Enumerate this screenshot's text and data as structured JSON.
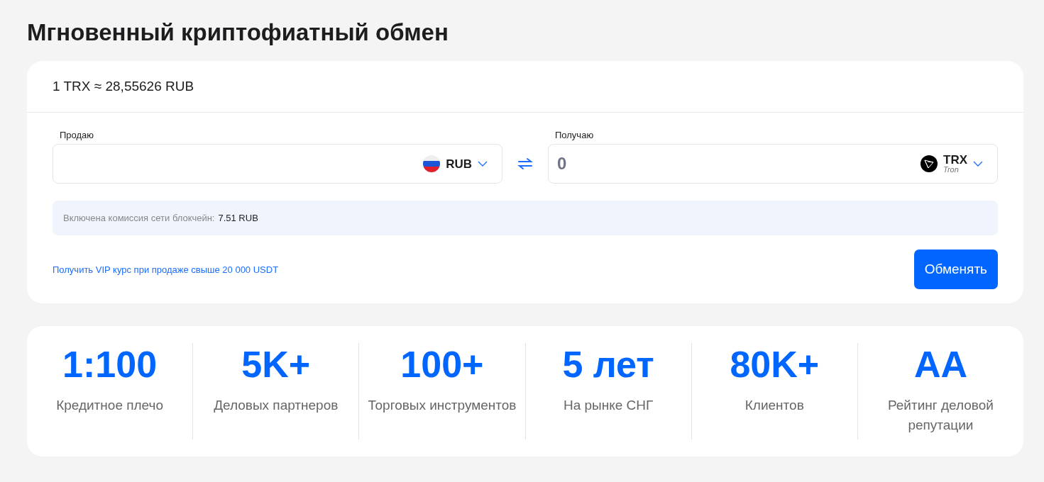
{
  "title": "Мгновенный криптофиатный обмен",
  "exchange": {
    "rate": "1 TRX ≈ 28,55626 RUB",
    "sell": {
      "label": "Продаю",
      "currency": "RUB",
      "kind": "flag"
    },
    "buy": {
      "label": "Получаю",
      "placeholder": "0",
      "currency": "TRX",
      "network": "Tron",
      "kind": "coin"
    },
    "fee": {
      "label": "Включена комиссия сети блокчейн:",
      "value": "7.51 RUB"
    },
    "vip_link": "Получить VIP курс при продаже свыше 20 000 USDT",
    "button": "Обменять"
  },
  "stats": [
    {
      "value": "1:100",
      "label": "Кредитное плечо"
    },
    {
      "value": "5K+",
      "label": "Деловых партнеров"
    },
    {
      "value": "100+",
      "label": "Торговых инструментов"
    },
    {
      "value": "5 лет",
      "label": "На рынке СНГ"
    },
    {
      "value": "80K+",
      "label": "Клиентов"
    },
    {
      "value": "AA",
      "label": "Рейтинг деловой репутации"
    }
  ]
}
